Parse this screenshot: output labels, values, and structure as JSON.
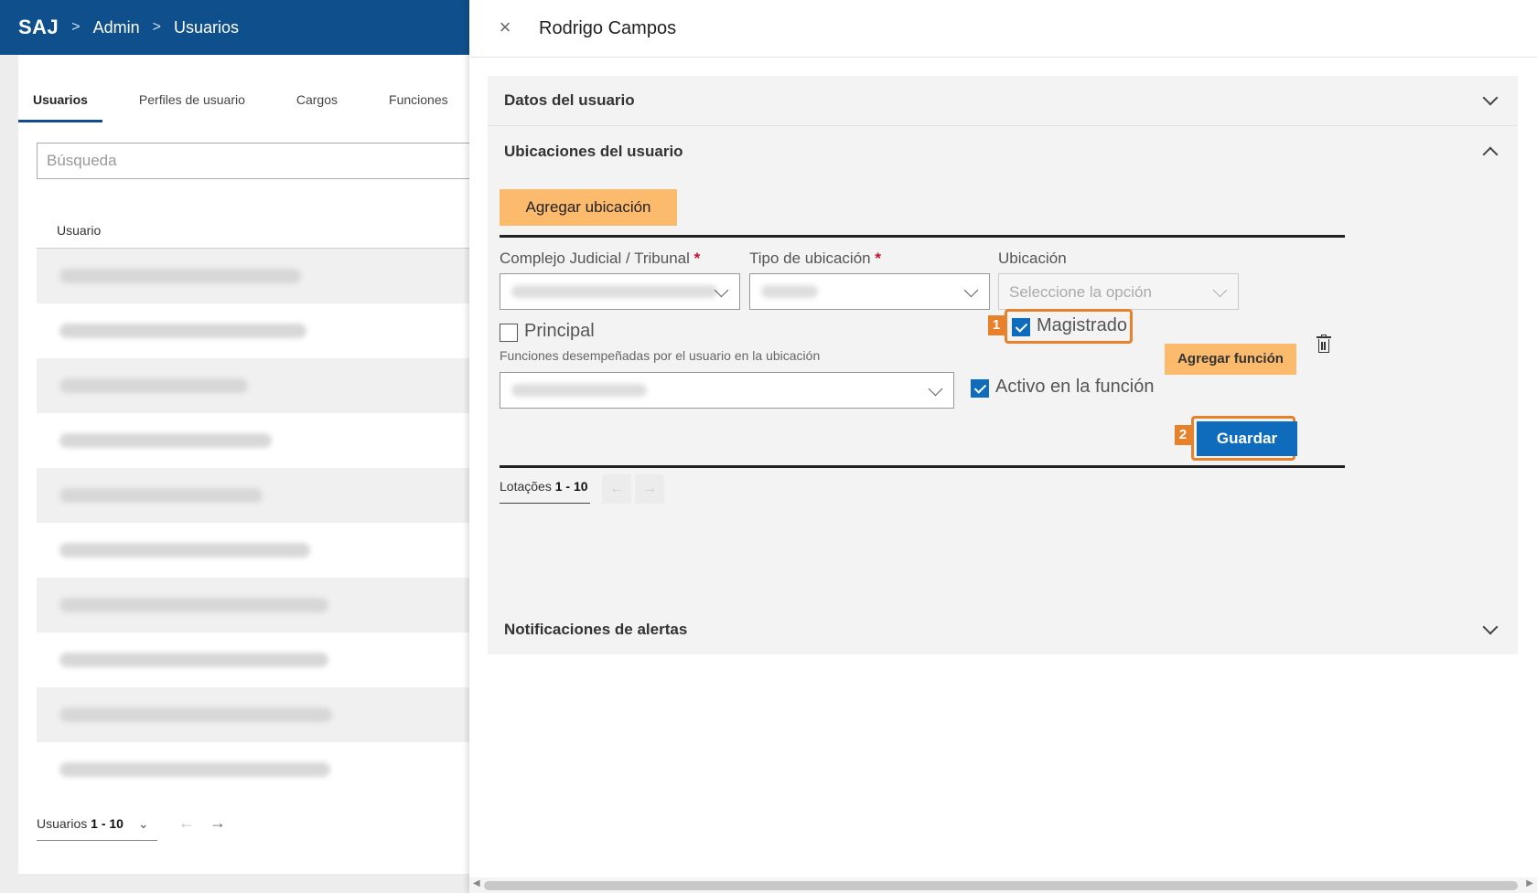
{
  "topbar": {
    "logo": "SAJ",
    "crumbs": [
      "Admin",
      "Usuarios"
    ]
  },
  "left": {
    "tabs": [
      "Usuarios",
      "Perfiles de usuario",
      "Cargos",
      "Funciones"
    ],
    "search_placeholder": "Búsqueda",
    "column_header": "Usuario",
    "pager_label": "Usuarios",
    "pager_range": "1 - 10"
  },
  "drawer": {
    "title": "Rodrigo Campos",
    "sections": {
      "datos": "Datos del usuario",
      "ubicaciones": "Ubicaciones del usuario",
      "notificaciones": "Notificaciones de alertas"
    },
    "add_location": "Agregar ubicación",
    "fields": {
      "complejo": "Complejo Judicial / Tribunal",
      "tipo": "Tipo de ubicación",
      "ubicacion": "Ubicación",
      "ubicacion_placeholder": "Seleccione la opción",
      "required_mark": "*"
    },
    "checkboxes": {
      "principal": {
        "label": "Principal",
        "checked": false
      },
      "magistrado": {
        "label": "Magistrado",
        "checked": true
      },
      "activo": {
        "label": "Activo en la función",
        "checked": true
      }
    },
    "functions_label": "Funciones desempeñadas por el usuario en la ubicación",
    "add_function": "Agregar función",
    "save": "Guardar",
    "badges": [
      "1",
      "2"
    ],
    "pager_label": "Lotações",
    "pager_range": "1 - 10"
  },
  "colors": {
    "brand": "#0f4f8c",
    "accent": "#fcba6c",
    "primary": "#0f6cbd",
    "highlight": "#e8822a"
  }
}
